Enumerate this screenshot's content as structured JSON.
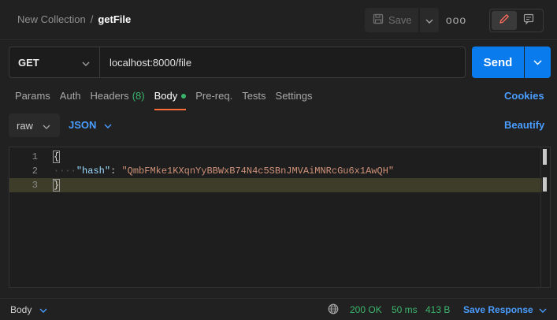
{
  "header": {
    "collection": "New Collection",
    "separator": "/",
    "request_name": "getFile",
    "save_label": "Save",
    "more_label": "ooo"
  },
  "request": {
    "method": "GET",
    "url": "localhost:8000/file",
    "send_label": "Send"
  },
  "tabs": [
    {
      "label": "Params"
    },
    {
      "label": "Auth"
    },
    {
      "label": "Headers",
      "count": "(8)"
    },
    {
      "label": "Body",
      "active": true
    },
    {
      "label": "Pre-req."
    },
    {
      "label": "Tests"
    },
    {
      "label": "Settings"
    }
  ],
  "cookies_label": "Cookies",
  "body_options": {
    "mode": "raw",
    "language": "JSON",
    "beautify_label": "Beautify"
  },
  "editor": {
    "line_numbers": [
      "1",
      "2",
      "3"
    ],
    "open_brace": "{",
    "indent": "····",
    "key": "\"hash\"",
    "colon": ": ",
    "value": "\"QmbFMke1KXqnYyBBWxB74N4c5SBnJMVAiMNRcGu6x1AwQH\"",
    "close_brace": "}"
  },
  "footer": {
    "body_label": "Body",
    "status": "200 OK",
    "time": "50 ms",
    "size": "413 B",
    "save_response_label": "Save Response"
  },
  "colors": {
    "accent": "#097bed",
    "link": "#4a9dff",
    "success": "#3bb56c",
    "active_tab_underline": "#ff6c37"
  }
}
